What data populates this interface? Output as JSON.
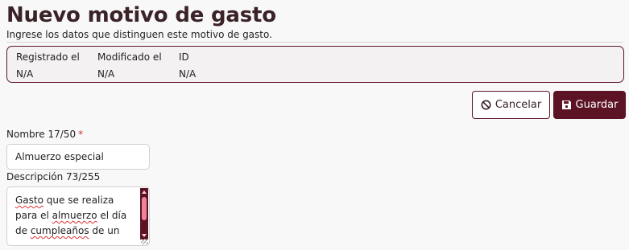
{
  "header": {
    "title": "Nuevo motivo de gasto",
    "subtitle": "Ingrese los datos que distinguen este motivo de gasto."
  },
  "meta": {
    "registered_label": "Registrado el",
    "registered_value": "N/A",
    "modified_label": "Modificado el",
    "modified_value": "N/A",
    "id_label": "ID",
    "id_value": "N/A"
  },
  "actions": {
    "cancel_label": "Cancelar",
    "cancel_icon": "ban-icon",
    "save_label": "Guardar",
    "save_icon": "floppy-disk-icon"
  },
  "form": {
    "nombre": {
      "label": "Nombre 17/50",
      "required_mark": "*",
      "value": "Almuerzo especial"
    },
    "descripcion": {
      "label": "Descripción 73/255",
      "lines": [
        [
          "Gasto",
          " que se realiza"
        ],
        [
          "para el ",
          "almuerzo",
          " el día"
        ],
        [
          "de ",
          "cumpleaños",
          " de un"
        ]
      ]
    }
  },
  "colors": {
    "accent": "#5c1425",
    "title": "#3a2328",
    "required": "#c0392b",
    "background": "#f9f8f8"
  }
}
